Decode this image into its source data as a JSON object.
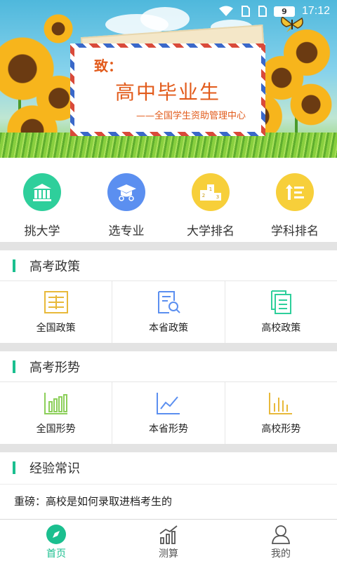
{
  "status_bar": {
    "battery": "9",
    "time": "17:12"
  },
  "banner": {
    "greeting": "致：",
    "title": "高中毕业生",
    "signature": "——全国学生资助管理中心"
  },
  "quick_nav": [
    {
      "label": "挑大学",
      "icon": "university-icon",
      "color": "#2ecf9b"
    },
    {
      "label": "选专业",
      "icon": "graduation-cap-icon",
      "color": "#5b8ff0"
    },
    {
      "label": "大学排名",
      "icon": "podium-icon",
      "color": "#f7cf3a"
    },
    {
      "label": "学科排名",
      "icon": "sort-list-icon",
      "color": "#f7cf3a"
    }
  ],
  "sections": {
    "policy": {
      "title": "高考政策",
      "items": [
        {
          "label": "全国政策",
          "icon": "document-grid-icon"
        },
        {
          "label": "本省政策",
          "icon": "document-search-icon"
        },
        {
          "label": "高校政策",
          "icon": "documents-copy-icon"
        }
      ]
    },
    "trend": {
      "title": "高考形势",
      "items": [
        {
          "label": "全国形势",
          "icon": "bar-chart-icon"
        },
        {
          "label": "本省形势",
          "icon": "line-chart-icon"
        },
        {
          "label": "高校形势",
          "icon": "column-chart-icon"
        }
      ]
    },
    "experience": {
      "title": "经验常识",
      "article": "重磅：高校是如何录取进档考生的"
    }
  },
  "tabbar": [
    {
      "label": "首页",
      "icon": "compass-icon",
      "active": true
    },
    {
      "label": "测算",
      "icon": "stats-icon",
      "active": false
    },
    {
      "label": "我的",
      "icon": "user-icon",
      "active": false
    }
  ],
  "colors": {
    "accent": "#1bbf8f",
    "banner_text": "#e25b1b"
  }
}
